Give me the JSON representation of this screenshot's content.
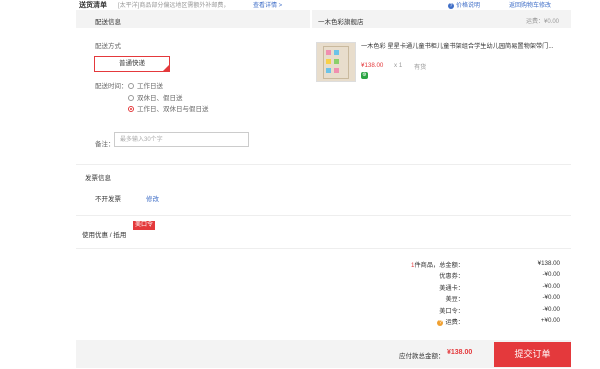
{
  "header": {
    "title": "送货清单",
    "note": "[太平洋]商品部分偏远地区需额外补邮费，",
    "note_link": "查看详情 >",
    "price_help": "价格说明",
    "back_cart": "返回购物车修改"
  },
  "shipping": {
    "section_title": "配送信息",
    "method_label": "配送方式",
    "method_option": "普通快递",
    "time_label": "配送时间：",
    "time_options": [
      {
        "label": "工作日送",
        "selected": false
      },
      {
        "label": "双休日、假日送",
        "selected": false
      },
      {
        "label": "工作日、双休日与假日送",
        "selected": true
      }
    ],
    "note_label": "备注：",
    "note_placeholder": "最多输入30个字"
  },
  "shop": {
    "name": "一木色彩旗舰店",
    "freight": "运费：¥0.00"
  },
  "product": {
    "title": "一木色彩 星星卡通儿童书柜儿童书架组合学生幼儿园简易置物架带门...",
    "price": "¥138.00",
    "qty": "x 1",
    "stock": "有货"
  },
  "invoice": {
    "section_title": "发票信息",
    "type": "不开发票",
    "edit": "修改"
  },
  "coupon": {
    "title": "使用优惠 / 抵用",
    "badge": "美口令"
  },
  "summary": {
    "rows": [
      {
        "label_prefix": "1",
        "label": "件商品，总金额：",
        "value": "¥138.00"
      },
      {
        "label": "优惠券：",
        "value": "-¥0.00"
      },
      {
        "label": "美通卡：",
        "value": "-¥0.00"
      },
      {
        "label": "美豆：",
        "value": "-¥0.00"
      },
      {
        "label": "美口令：",
        "value": "-¥0.00"
      },
      {
        "label": "运费：",
        "value": "+¥0.00"
      }
    ]
  },
  "footer": {
    "pay_label": "应付款总金额：",
    "pay_amount": "¥138.00",
    "submit": "提交订单"
  }
}
